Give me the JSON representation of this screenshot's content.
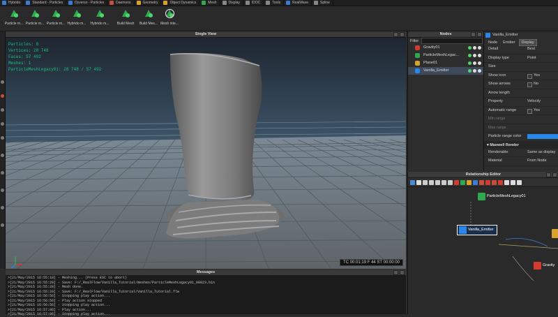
{
  "tabs": [
    {
      "label": "Hybrido",
      "color": "#3a7bd5"
    },
    {
      "label": "Standard - Particles",
      "color": "#3a7bd5"
    },
    {
      "label": "Dyverso - Particles",
      "color": "#3a7bd5"
    },
    {
      "label": "Daemons",
      "color": "#c94d3a"
    },
    {
      "label": "Geometry",
      "color": "#d9a32b"
    },
    {
      "label": "Object Dynamics",
      "color": "#d9a32b"
    },
    {
      "label": "Mesh",
      "color": "#2fa84f"
    },
    {
      "label": "Display",
      "color": "#888888"
    },
    {
      "label": "IDOC",
      "color": "#888888"
    },
    {
      "label": "Tools",
      "color": "#888888"
    },
    {
      "label": "RealWave",
      "color": "#3a7bd5"
    },
    {
      "label": "Spline",
      "color": "#888888"
    }
  ],
  "tools": [
    {
      "label": "Particle m...",
      "icon": "particle-mesh-icon"
    },
    {
      "label": "Particle m...",
      "icon": "particle-mesh-icon"
    },
    {
      "label": "Particle m...",
      "icon": "particle-mesh-icon"
    },
    {
      "label": "Hybrido m...",
      "icon": "hybrido-mesh-icon"
    },
    {
      "label": "Hybrido m...",
      "icon": "hybrido-mesh-icon"
    },
    {
      "label": "Build Mesh",
      "icon": "build-mesh-icon"
    },
    {
      "label": "Build Mes...",
      "icon": "build-mesh-icon"
    },
    {
      "label": "Mesh inte...",
      "icon": "mesh-interpolate-icon"
    }
  ],
  "viewport": {
    "title": "Single View",
    "hud": [
      "Particles: 0",
      "Vertices: 28 748",
      "Faces: 57 492",
      "Meshes: 1",
      "ParticleMeshLegacy01: 28 748 / 57 492"
    ],
    "timebar": "TC 00:01:19   F 44   ST 00:00:00"
  },
  "messages": {
    "title": "Messages",
    "lines": [
      ">[21/May/2015 16:55:18] - Meshing... (Press ESC to abort)",
      ">[21/May/2015 16:55:20] - Save: F:/_RealFlow/Vanilla_Tutorial/meshes/ParticleMeshLegacy01_00023.bin",
      ">[21/May/2015 16:55:20] - Mesh done.",
      ">[21/May/2015 16:55:20] - Save: F:/_RealFlow/Vanilla_Tutorial/Vanilla_Tutorial.flw",
      ">[21/May/2015 16:56:56] - Stopping play action...",
      ">[21/May/2015 16:56:56] - Play action stopped",
      ">[21/May/2015 16:56:56] - Stopping play action...",
      ">[21/May/2015 16:57:06] - Play action...",
      ">[21/May/2015 16:57:06] - Stopping play action..."
    ]
  },
  "nodes": {
    "title": "Nodes",
    "filter_label": "Filter",
    "items": [
      {
        "label": "Gravity01",
        "color": "#d23b2f"
      },
      {
        "label": "ParticleMeshLegac...",
        "color": "#2fa84f"
      },
      {
        "label": "Plane01",
        "color": "#d9a32b"
      },
      {
        "label": "Vanilla_Emitter",
        "color": "#2a86e8"
      }
    ]
  },
  "props": {
    "title": "Vanilla_Emitter",
    "tabs": [
      "Node",
      "Emitter",
      "Display"
    ],
    "rows": [
      {
        "k": "Detail",
        "v": "Best"
      },
      {
        "k": "Display type",
        "v": "Point"
      },
      {
        "k": "Size",
        "v": ""
      },
      {
        "k": "Show icon",
        "v": "Yes"
      },
      {
        "k": "Show arrows",
        "v": "No"
      },
      {
        "k": "Arrow length",
        "v": ""
      },
      {
        "k": "Property",
        "v": "Velocity"
      },
      {
        "k": "Automatic range",
        "v": "Yes"
      },
      {
        "k": "Min range",
        "v": ""
      },
      {
        "k": "Max range",
        "v": ""
      },
      {
        "k": "Particle range color",
        "v": ""
      }
    ],
    "section": "Maxwell Render",
    "rows2": [
      {
        "k": "Renderable",
        "v": "Same as display"
      },
      {
        "k": "Material",
        "v": "From Node"
      }
    ]
  },
  "relationship": {
    "title": "Relationship Editor",
    "nodes": [
      {
        "label": "ParticleMeshLegacy01",
        "color": "#2fa84f"
      },
      {
        "label": "Vanilla_Emitter",
        "color": "#2a86e8"
      },
      {
        "label": "Gravity",
        "color": "#d23b2f"
      }
    ]
  }
}
